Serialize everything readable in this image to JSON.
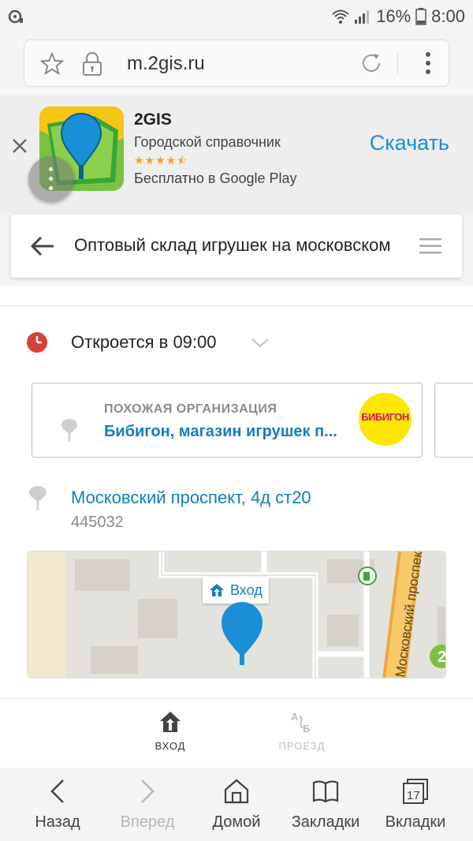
{
  "status_bar": {
    "battery_percent": "16%",
    "time": "8:00"
  },
  "browser": {
    "url": "m.2gis.ru"
  },
  "app_banner": {
    "app_name": "2GIS",
    "subtitle": "Городской справочник",
    "rating": 4.5,
    "rating_stars": "★★★★⯪",
    "store_text": "Бесплатно в Google Play",
    "download_label": "Скачать"
  },
  "header": {
    "title": "Оптовый склад игрушек на московском"
  },
  "place": {
    "hours": "Откроется в 09:00",
    "similar_org": {
      "label": "ПОХОЖАЯ ОРГАНИЗАЦИЯ",
      "name": "Бибигон, магазин игрушек п...",
      "logo_text": "БИБИГОН"
    },
    "address": "Московский проспект, 4д ст20",
    "postal_code": "445032"
  },
  "map": {
    "entrance_label": "Вход",
    "street_label": "Московский проспект",
    "badge_number": "2"
  },
  "mode_tabs": [
    {
      "label": "ВХОД",
      "active": true
    },
    {
      "label": "ПРОЕЗД",
      "active": false
    }
  ],
  "browser_nav": {
    "back": "Назад",
    "forward": "Вперед",
    "home": "Домой",
    "bookmarks": "Закладки",
    "tabs": "Вкладки",
    "tabs_count": "17"
  },
  "colors": {
    "accent_blue": "#1a8fd6",
    "link_blue": "#137dbf",
    "clock_red": "#d9403a",
    "pin_blue": "#1a8fd6"
  }
}
